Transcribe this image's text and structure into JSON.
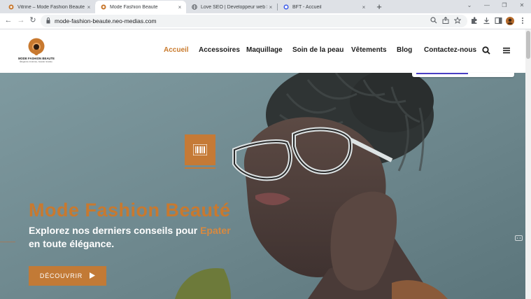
{
  "browser": {
    "tabs": [
      {
        "title": "Vitrine – Mode Fashion Beaute",
        "active": false,
        "favicon": "fashion-logo-favicon"
      },
      {
        "title": "Mode Fashion Beaute",
        "active": true,
        "favicon": "fashion-logo-favicon"
      },
      {
        "title": "Love SEO | Developpeur web SEO",
        "active": false,
        "favicon": "globe-favicon"
      },
      {
        "title": "BFT - Accueil",
        "active": false,
        "favicon": "wordpress-favicon"
      }
    ],
    "close_glyph": "×",
    "new_tab_glyph": "+",
    "url": "mode-fashion-beaute.neo-medias.com",
    "nav": {
      "back": "←",
      "forward": "→",
      "reload": "↻"
    },
    "window_controls": {
      "minimize": "⌄",
      "restore": "—",
      "maximize": "❐",
      "close": "✕"
    },
    "toolbar_icons": [
      "zoom-icon",
      "share-icon",
      "star-icon",
      "extensions-icon",
      "download-icon",
      "sidepanel-icon",
      "profile-avatar",
      "menu-icon"
    ]
  },
  "site": {
    "logo": {
      "name": "MODE FASHION BEAUTE",
      "tagline": "Élégance incarnée, beauté révélée."
    },
    "nav": [
      {
        "label": "Accueil",
        "active": true
      },
      {
        "label": "Accessoires",
        "active": false
      },
      {
        "label": "Maquillage",
        "active": false
      },
      {
        "label": "Soin de la peau",
        "active": false
      },
      {
        "label": "Vêtements",
        "active": false
      },
      {
        "label": "Blog",
        "active": false
      },
      {
        "label": "Contactez-nous",
        "active": false
      }
    ],
    "search_icon": "search-icon",
    "menu_icon": "hamburger-menu-icon"
  },
  "hero": {
    "title": "Mode Fashion Beauté",
    "subtitle_part1": "Explorez nos derniers conseils pour ",
    "subtitle_accent": "Epater",
    "subtitle_part2": "en toute élégance.",
    "cta_label": "DÉCOUVRIR",
    "cta_icon": "play-icon",
    "badge_icon": "barcode-icon"
  },
  "colors": {
    "accent": "#c8792f",
    "hero_overlay": "#6f8a90",
    "nav_text": "#1c1c1c"
  }
}
